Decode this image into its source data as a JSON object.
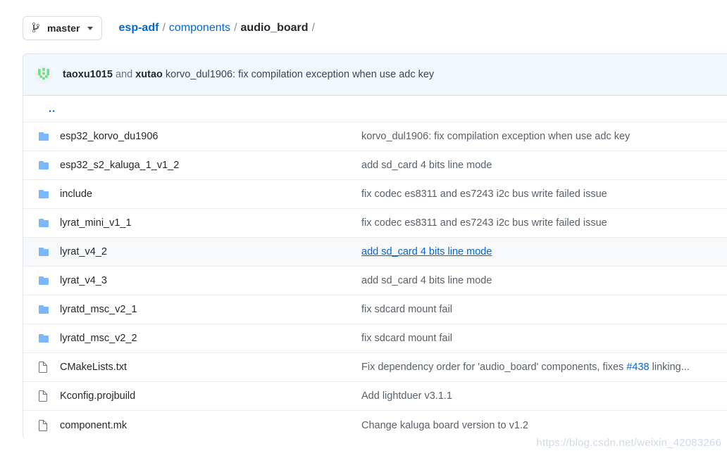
{
  "branch": {
    "label": "master",
    "icon": "git-branch-icon",
    "caret": "chevron-down-icon"
  },
  "breadcrumb": {
    "repo": "esp-adf",
    "sep": "/",
    "parts": [
      {
        "label": "components",
        "link": true
      },
      {
        "label": "audio_board",
        "link": false
      }
    ],
    "trailing": "/"
  },
  "commit_banner": {
    "avatar": "avatar-identicon",
    "author": "taoxu1015",
    "conjunction": "and",
    "coauthor": "xutao",
    "message": "korvo_dul1906: fix compilation exception when use adc key"
  },
  "parent_row": {
    "label": ".."
  },
  "files": [
    {
      "icon": "folder-icon",
      "type": "folder",
      "name": "esp32_korvo_du1906",
      "message": "korvo_dul1906: fix compilation exception when use adc key",
      "hovered": false,
      "link": false
    },
    {
      "icon": "folder-icon",
      "type": "folder",
      "name": "esp32_s2_kaluga_1_v1_2",
      "message": "add sd_card 4 bits line mode",
      "hovered": false,
      "link": false
    },
    {
      "icon": "folder-icon",
      "type": "folder",
      "name": "include",
      "message": "fix codec es8311 and es7243 i2c bus write failed issue",
      "hovered": false,
      "link": false
    },
    {
      "icon": "folder-icon",
      "type": "folder",
      "name": "lyrat_mini_v1_1",
      "message": "fix codec es8311 and es7243 i2c bus write failed issue",
      "hovered": false,
      "link": false
    },
    {
      "icon": "folder-icon",
      "type": "folder",
      "name": "lyrat_v4_2",
      "message": "add sd_card 4 bits line mode",
      "hovered": true,
      "link": true
    },
    {
      "icon": "folder-icon",
      "type": "folder",
      "name": "lyrat_v4_3",
      "message": "add sd_card 4 bits line mode",
      "hovered": false,
      "link": false
    },
    {
      "icon": "folder-icon",
      "type": "folder",
      "name": "lyratd_msc_v2_1",
      "message": "fix sdcard mount fail",
      "hovered": false,
      "link": false
    },
    {
      "icon": "folder-icon",
      "type": "folder",
      "name": "lyratd_msc_v2_2",
      "message": "fix sdcard mount fail",
      "hovered": false,
      "link": false
    },
    {
      "icon": "file-icon",
      "type": "file",
      "name": "CMakeLists.txt",
      "message": "Fix dependency order for 'audio_board' components, fixes #438 linking...",
      "message_prefix": "Fix dependency order for 'audio_board' components, ",
      "message_dotted": "fixes",
      "message_issue": "#438",
      "message_suffix": " linking...",
      "hovered": false,
      "link": false
    },
    {
      "icon": "file-icon",
      "type": "file",
      "name": "Kconfig.projbuild",
      "message": "Add lightduer v3.1.1",
      "hovered": false,
      "link": false
    },
    {
      "icon": "file-icon",
      "type": "file",
      "name": "component.mk",
      "message": "Change kaluga board version to v1.2",
      "hovered": false,
      "link": false
    }
  ],
  "watermark": {
    "text": "https://blog.csdn.net/weixin_42083266"
  },
  "colors": {
    "link": "#0366d6",
    "folder": "#79b8ff",
    "banner_bg": "#f1f8ff",
    "banner_border": "#c8e1ff",
    "row_border": "#eaecef",
    "hover_bg": "#f6f8fa",
    "text": "#24292e",
    "muted": "#586069"
  }
}
